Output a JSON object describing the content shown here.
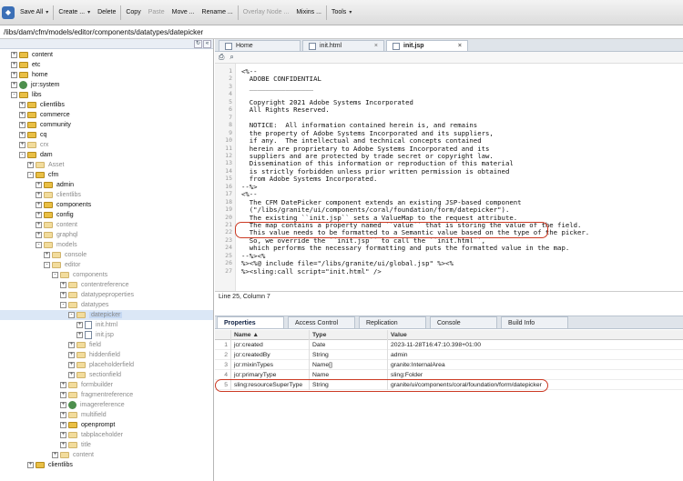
{
  "toolbar": {
    "save_all": "Save All",
    "create": "Create ...",
    "delete": "Delete",
    "copy": "Copy",
    "paste": "Paste",
    "move": "Move ...",
    "rename": "Rename ...",
    "overlay_node": "Overlay Node ...",
    "mixins": "Mixins ...",
    "tools": "Tools"
  },
  "path": "/libs/dam/cfm/models/editor/components/datatypes/datepicker",
  "tree": {
    "collapse_label": "«",
    "items": [
      {
        "label": "content",
        "depth": 1,
        "exp": "+",
        "dim": false
      },
      {
        "label": "etc",
        "depth": 1,
        "exp": "+",
        "dim": false
      },
      {
        "label": "home",
        "depth": 1,
        "exp": "+",
        "dim": false
      },
      {
        "label": "jcr:system",
        "depth": 1,
        "exp": "+",
        "dim": false,
        "icon": "gear"
      },
      {
        "label": "libs",
        "depth": 1,
        "exp": "-",
        "dim": false
      },
      {
        "label": "clientlibs",
        "depth": 2,
        "exp": "+",
        "dim": false
      },
      {
        "label": "commerce",
        "depth": 2,
        "exp": "+",
        "dim": false
      },
      {
        "label": "community",
        "depth": 2,
        "exp": "+",
        "dim": false
      },
      {
        "label": "cq",
        "depth": 2,
        "exp": "+",
        "dim": false
      },
      {
        "label": "crx",
        "depth": 2,
        "exp": "+",
        "dim": true
      },
      {
        "label": "dam",
        "depth": 2,
        "exp": "-",
        "dim": false
      },
      {
        "label": "Asset",
        "depth": 3,
        "exp": "+",
        "dim": true
      },
      {
        "label": "cfm",
        "depth": 3,
        "exp": "-",
        "dim": false
      },
      {
        "label": "admin",
        "depth": 4,
        "exp": "+",
        "dim": false
      },
      {
        "label": "clientlibs",
        "depth": 4,
        "exp": "+",
        "dim": true
      },
      {
        "label": "components",
        "depth": 4,
        "exp": "+",
        "dim": false
      },
      {
        "label": "config",
        "depth": 4,
        "exp": "+",
        "dim": false
      },
      {
        "label": "content",
        "depth": 4,
        "exp": "+",
        "dim": true
      },
      {
        "label": "graphql",
        "depth": 4,
        "exp": "+",
        "dim": true
      },
      {
        "label": "models",
        "depth": 4,
        "exp": "-",
        "dim": true
      },
      {
        "label": "console",
        "depth": 5,
        "exp": "+",
        "dim": true
      },
      {
        "label": "editor",
        "depth": 5,
        "exp": "-",
        "dim": true
      },
      {
        "label": "components",
        "depth": 6,
        "exp": "-",
        "dim": true
      },
      {
        "label": "contentreference",
        "depth": 7,
        "exp": "+",
        "dim": true
      },
      {
        "label": "datatypeproperties",
        "depth": 7,
        "exp": "+",
        "dim": true
      },
      {
        "label": "datatypes",
        "depth": 7,
        "exp": "-",
        "dim": true
      },
      {
        "label": "datepicker",
        "depth": 8,
        "exp": "-",
        "dim": true,
        "selected": true
      },
      {
        "label": "init.html",
        "depth": 9,
        "exp": "+",
        "dim": true,
        "icon": "file"
      },
      {
        "label": "init.jsp",
        "depth": 9,
        "exp": "+",
        "dim": true,
        "icon": "file"
      },
      {
        "label": "field",
        "depth": 8,
        "exp": "+",
        "dim": true
      },
      {
        "label": "hiddenfield",
        "depth": 8,
        "exp": "+",
        "dim": true
      },
      {
        "label": "placeholderfield",
        "depth": 8,
        "exp": "+",
        "dim": true
      },
      {
        "label": "sectionfield",
        "depth": 8,
        "exp": "+",
        "dim": true
      },
      {
        "label": "formbuilder",
        "depth": 7,
        "exp": "+",
        "dim": true
      },
      {
        "label": "fragmentreference",
        "depth": 7,
        "exp": "+",
        "dim": true
      },
      {
        "label": "imagereference",
        "depth": 7,
        "exp": "+",
        "dim": true,
        "icon": "gear"
      },
      {
        "label": "multifield",
        "depth": 7,
        "exp": "+",
        "dim": true
      },
      {
        "label": "openprompt",
        "depth": 7,
        "exp": "+",
        "dim": false
      },
      {
        "label": "tabplaceholder",
        "depth": 7,
        "exp": "+",
        "dim": true
      },
      {
        "label": "title",
        "depth": 7,
        "exp": "+",
        "dim": true
      },
      {
        "label": "content",
        "depth": 6,
        "exp": "+",
        "dim": true
      },
      {
        "label": "clientlibs",
        "depth": 3,
        "exp": "+",
        "dim": false
      }
    ]
  },
  "editor_tabs": [
    {
      "label": "Home",
      "close": ""
    },
    {
      "label": "init.html",
      "close": "×"
    },
    {
      "label": "init.jsp",
      "close": "×"
    }
  ],
  "editor_tools": {
    "save_icon": "⎙",
    "find_icon": "⌕"
  },
  "code_lines": [
    "<%--",
    "  ADOBE CONFIDENTIAL",
    "  ________________",
    "",
    "  Copyright 2021 Adobe Systems Incorporated",
    "  All Rights Reserved.",
    "",
    "  NOTICE:  All information contained herein is, and remains",
    "  the property of Adobe Systems Incorporated and its suppliers,",
    "  if any.  The intellectual and technical concepts contained",
    "  herein are proprietary to Adobe Systems Incorporated and its",
    "  suppliers and are protected by trade secret or copyright law.",
    "  Dissemination of this information or reproduction of this material",
    "  is strictly forbidden unless prior written permission is obtained",
    "  from Adobe Systems Incorporated.",
    "--%>",
    "<%--",
    "  The CFM DatePicker component extends an existing JSP-based component",
    "  (\"/libs/granite/ui/components/coral/foundation/form/datepicker\").",
    "  The existing ``init.jsp`` sets a ValueMap to the request attribute.",
    "  The map contains a property named ``value`` that is storing the value of the field.",
    "  This value needs to be formatted to a Semantic value based on the type of the picker.",
    "  So, we override the ``init.jsp`` to call the ``init.html``,",
    "  which performs the necessary formatting and puts the formatted value in the map.",
    "--%><%",
    "%><%@ include file=\"/libs/granite/ui/global.jsp\" %><%",
    "%><sling:call script=\"init.html\" />"
  ],
  "status": "Line 25, Column 7",
  "prop_tabs": [
    "Properties",
    "Access Control",
    "Replication",
    "Console",
    "Build Info"
  ],
  "grid": {
    "headers": [
      "Name ▲",
      "Type",
      "Value"
    ],
    "rows": [
      {
        "n": "1",
        "name": "jcr:created",
        "type": "Date",
        "value": "2023-11-28T16:47:10.398+01:00"
      },
      {
        "n": "2",
        "name": "jcr:createdBy",
        "type": "String",
        "value": "admin"
      },
      {
        "n": "3",
        "name": "jcr:mixinTypes",
        "type": "Name[]",
        "value": "granite:InternalArea"
      },
      {
        "n": "4",
        "name": "jcr:primaryType",
        "type": "Name",
        "value": "sling:Folder"
      },
      {
        "n": "5",
        "name": "sling:resourceSuperType",
        "type": "String",
        "value": "granite/ui/components/coral/foundation/form/datepicker"
      }
    ]
  },
  "colors": {
    "highlight": "#cc3a24",
    "folder": "#e9bf45",
    "selection": "#c5d8f2"
  }
}
